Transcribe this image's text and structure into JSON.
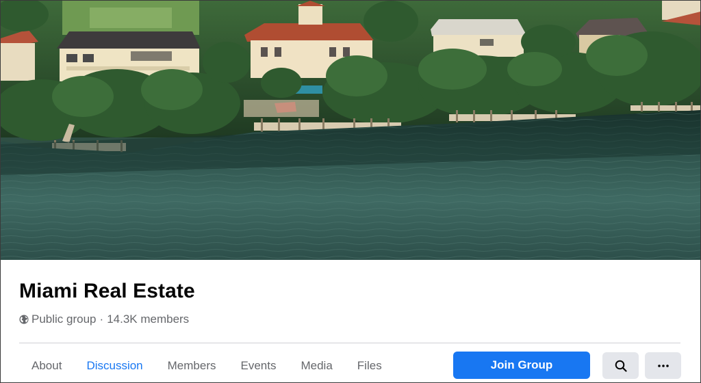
{
  "group": {
    "name": "Miami Real Estate",
    "privacy": "Public group",
    "separator": "·",
    "members": "14.3K members"
  },
  "tabs": [
    {
      "label": "About",
      "active": false
    },
    {
      "label": "Discussion",
      "active": true
    },
    {
      "label": "Members",
      "active": false
    },
    {
      "label": "Events",
      "active": false
    },
    {
      "label": "Media",
      "active": false
    },
    {
      "label": "Files",
      "active": false
    }
  ],
  "actions": {
    "join_label": "Join Group",
    "search_icon": "search-icon",
    "more_icon": "more-horizontal-icon"
  },
  "cover": {
    "subject": "aerial-waterfront-villas"
  },
  "colors": {
    "accent": "#1877f2",
    "text_primary": "#050505",
    "text_secondary": "#65676b",
    "button_secondary_bg": "#e4e6eb",
    "divider": "#ced0d4"
  },
  "icons": {
    "privacy": "globe-icon"
  }
}
